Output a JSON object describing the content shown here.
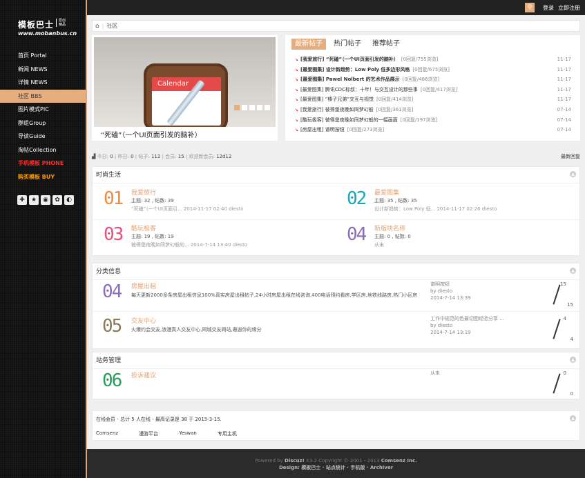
{
  "logo": {
    "title": "模板巴士",
    "sub1": "原创",
    "sub2": "精品",
    "url": "www.mobanbus.cn"
  },
  "nav": [
    {
      "label": "首页 Portal",
      "style": "normal"
    },
    {
      "label": "新闻 NEWS",
      "style": "normal"
    },
    {
      "label": "详情 NEWS",
      "style": "normal"
    },
    {
      "label": "社区 BBS",
      "style": "active"
    },
    {
      "label": "图片模式PIC",
      "style": "normal"
    },
    {
      "label": "群组Group",
      "style": "normal"
    },
    {
      "label": "导读Guide",
      "style": "normal"
    },
    {
      "label": "淘帖Collection",
      "style": "normal"
    },
    {
      "label": "手机模板 PHONE",
      "style": "red"
    },
    {
      "label": "购买模板 BUY",
      "style": "orange"
    }
  ],
  "social_icons": [
    "plus-grid-icon",
    "star-icon",
    "weibo-icon",
    "qzone-icon",
    "wechat-icon"
  ],
  "topbar": {
    "login": "登录",
    "register": "立即注册"
  },
  "breadcrumb": {
    "current": "社区"
  },
  "slider": {
    "image_title": "Calendar",
    "caption": "“死磕”（一个UI页面引发的脑补）"
  },
  "posts": {
    "tabs": [
      "最新帖子",
      "热门帖子",
      "推荐帖子"
    ],
    "items": [
      {
        "title": "[我爱旅行] “死磕”（一个UI页面引发的脑补）",
        "meta": "[0回复/755浏览]",
        "date": "11-17",
        "bold": true
      },
      {
        "title": "[最爱图集] 设计新趋势：Low Poly 低多边形风格",
        "meta": "[0回复/675浏览]",
        "date": "11-17",
        "bold": true
      },
      {
        "title": "[最爱图集] Pawel Nolbert 的艺术作品展示",
        "meta": "[0回复/466浏览]",
        "date": "11-17",
        "bold": true
      },
      {
        "title": "[最爱图集] 腾讯CDC标叔：十年！与交互设计的那些事",
        "meta": "[0回复/417浏览]",
        "date": "11-17",
        "bold": false
      },
      {
        "title": "[最爱图集] “榛子兄弟”交互与视觉",
        "meta": "[0回复/414浏览]",
        "date": "11-17",
        "bold": false
      },
      {
        "title": "[我爱旅行] 彼得堡夜晚如同梦幻般",
        "meta": "[0回复/361浏览]",
        "date": "07-14",
        "bold": false
      },
      {
        "title": "[酷玩极客] 彼得堡夜晚如同梦幻般的一幅画面",
        "meta": "[0回复/197浏览]",
        "date": "07-14",
        "bold": false
      },
      {
        "title": "[房屋出租] 谱明按钮",
        "meta": "[0回复/273浏览]",
        "date": "07-14",
        "bold": false
      }
    ]
  },
  "stats": {
    "today_label": "今日:",
    "today": "0",
    "yesterday_label": "昨日:",
    "yesterday": "0",
    "posts_label": "帖子:",
    "posts": "112",
    "members_label": "会员:",
    "members": "15",
    "welcome_label": "欢迎新会员:",
    "newest": "12d12",
    "right": "最新回复"
  },
  "sections": {
    "life": {
      "title": "时尚生活",
      "forums": [
        {
          "num": "01",
          "color": "#f08a3c",
          "name": "我爱旅行",
          "stats": "主题: 32 , 帖数: 39",
          "last": "“死磕”（一个UI页面引... 2014-11-17 02:40 diesto"
        },
        {
          "num": "02",
          "color": "#1aa5b8",
          "name": "最爱图集",
          "stats": "主题: 35 , 帖数: 35",
          "last": "设计新趋势：Low Poly 低... 2014-11-17 02:26 diesto"
        },
        {
          "num": "03",
          "color": "#e8527a",
          "name": "酷玩极客",
          "stats": "主题: 19 , 帖数: 19",
          "last": "彼得堡夜晚如同梦幻般的... 2014-7-14 13:40 diesto"
        },
        {
          "num": "04",
          "color": "#8a6bbd",
          "name": "新版块名称",
          "stats": "主题: 0 , 帖数: 0",
          "last": "从未"
        }
      ]
    },
    "classified": {
      "title": "分类信息",
      "forums": [
        {
          "num": "04",
          "color": "#8a6bbd",
          "name": "房屋出租",
          "desc": "每天更新2000多条房屋出租信息100%真实房屋出租帖子,24小时房屋出租在线咨询,400电话预约看房,学区房,地铁线路房,热门小区房",
          "last1": "谱明按钮",
          "last2": "by diesto",
          "last3": "2014-7-14 13:39",
          "top": "15",
          "bottom": "15"
        },
        {
          "num": "05",
          "color": "#8a7a5a",
          "name": "交友中心",
          "desc": "火爆约会交友,浪漫真人交友中心,同城交友网站,邂逅你的缘分",
          "last1": "工作中规范的色最切图经验分享 ...",
          "last2": "by diesto",
          "last3": "2014-7-14 13:19",
          "top": "4",
          "bottom": "4"
        }
      ]
    },
    "admin": {
      "title": "站务管理",
      "forums": [
        {
          "num": "06",
          "color": "#2a9a5a",
          "name": "投诉建议",
          "desc": "",
          "last1": "从未",
          "last2": "",
          "last3": "",
          "top": "0",
          "bottom": "0"
        }
      ]
    },
    "online": {
      "title": "在线会员 - 总计 5 人在线 - 最高记录是 38 于 2015-3-15.",
      "items": [
        "Comsenz",
        "漫游平台",
        "Yeswan",
        "专用主机"
      ]
    }
  },
  "footer": {
    "line1_a": "Powered by ",
    "line1_b": "Discuz!",
    "line1_c": " X3.2 Copyright © 2001 - 2013 ",
    "line1_d": "Comsenz Inc.",
    "line2": "Design: 模板巴士 · 站点统计 · 手机版 · Archiver"
  }
}
